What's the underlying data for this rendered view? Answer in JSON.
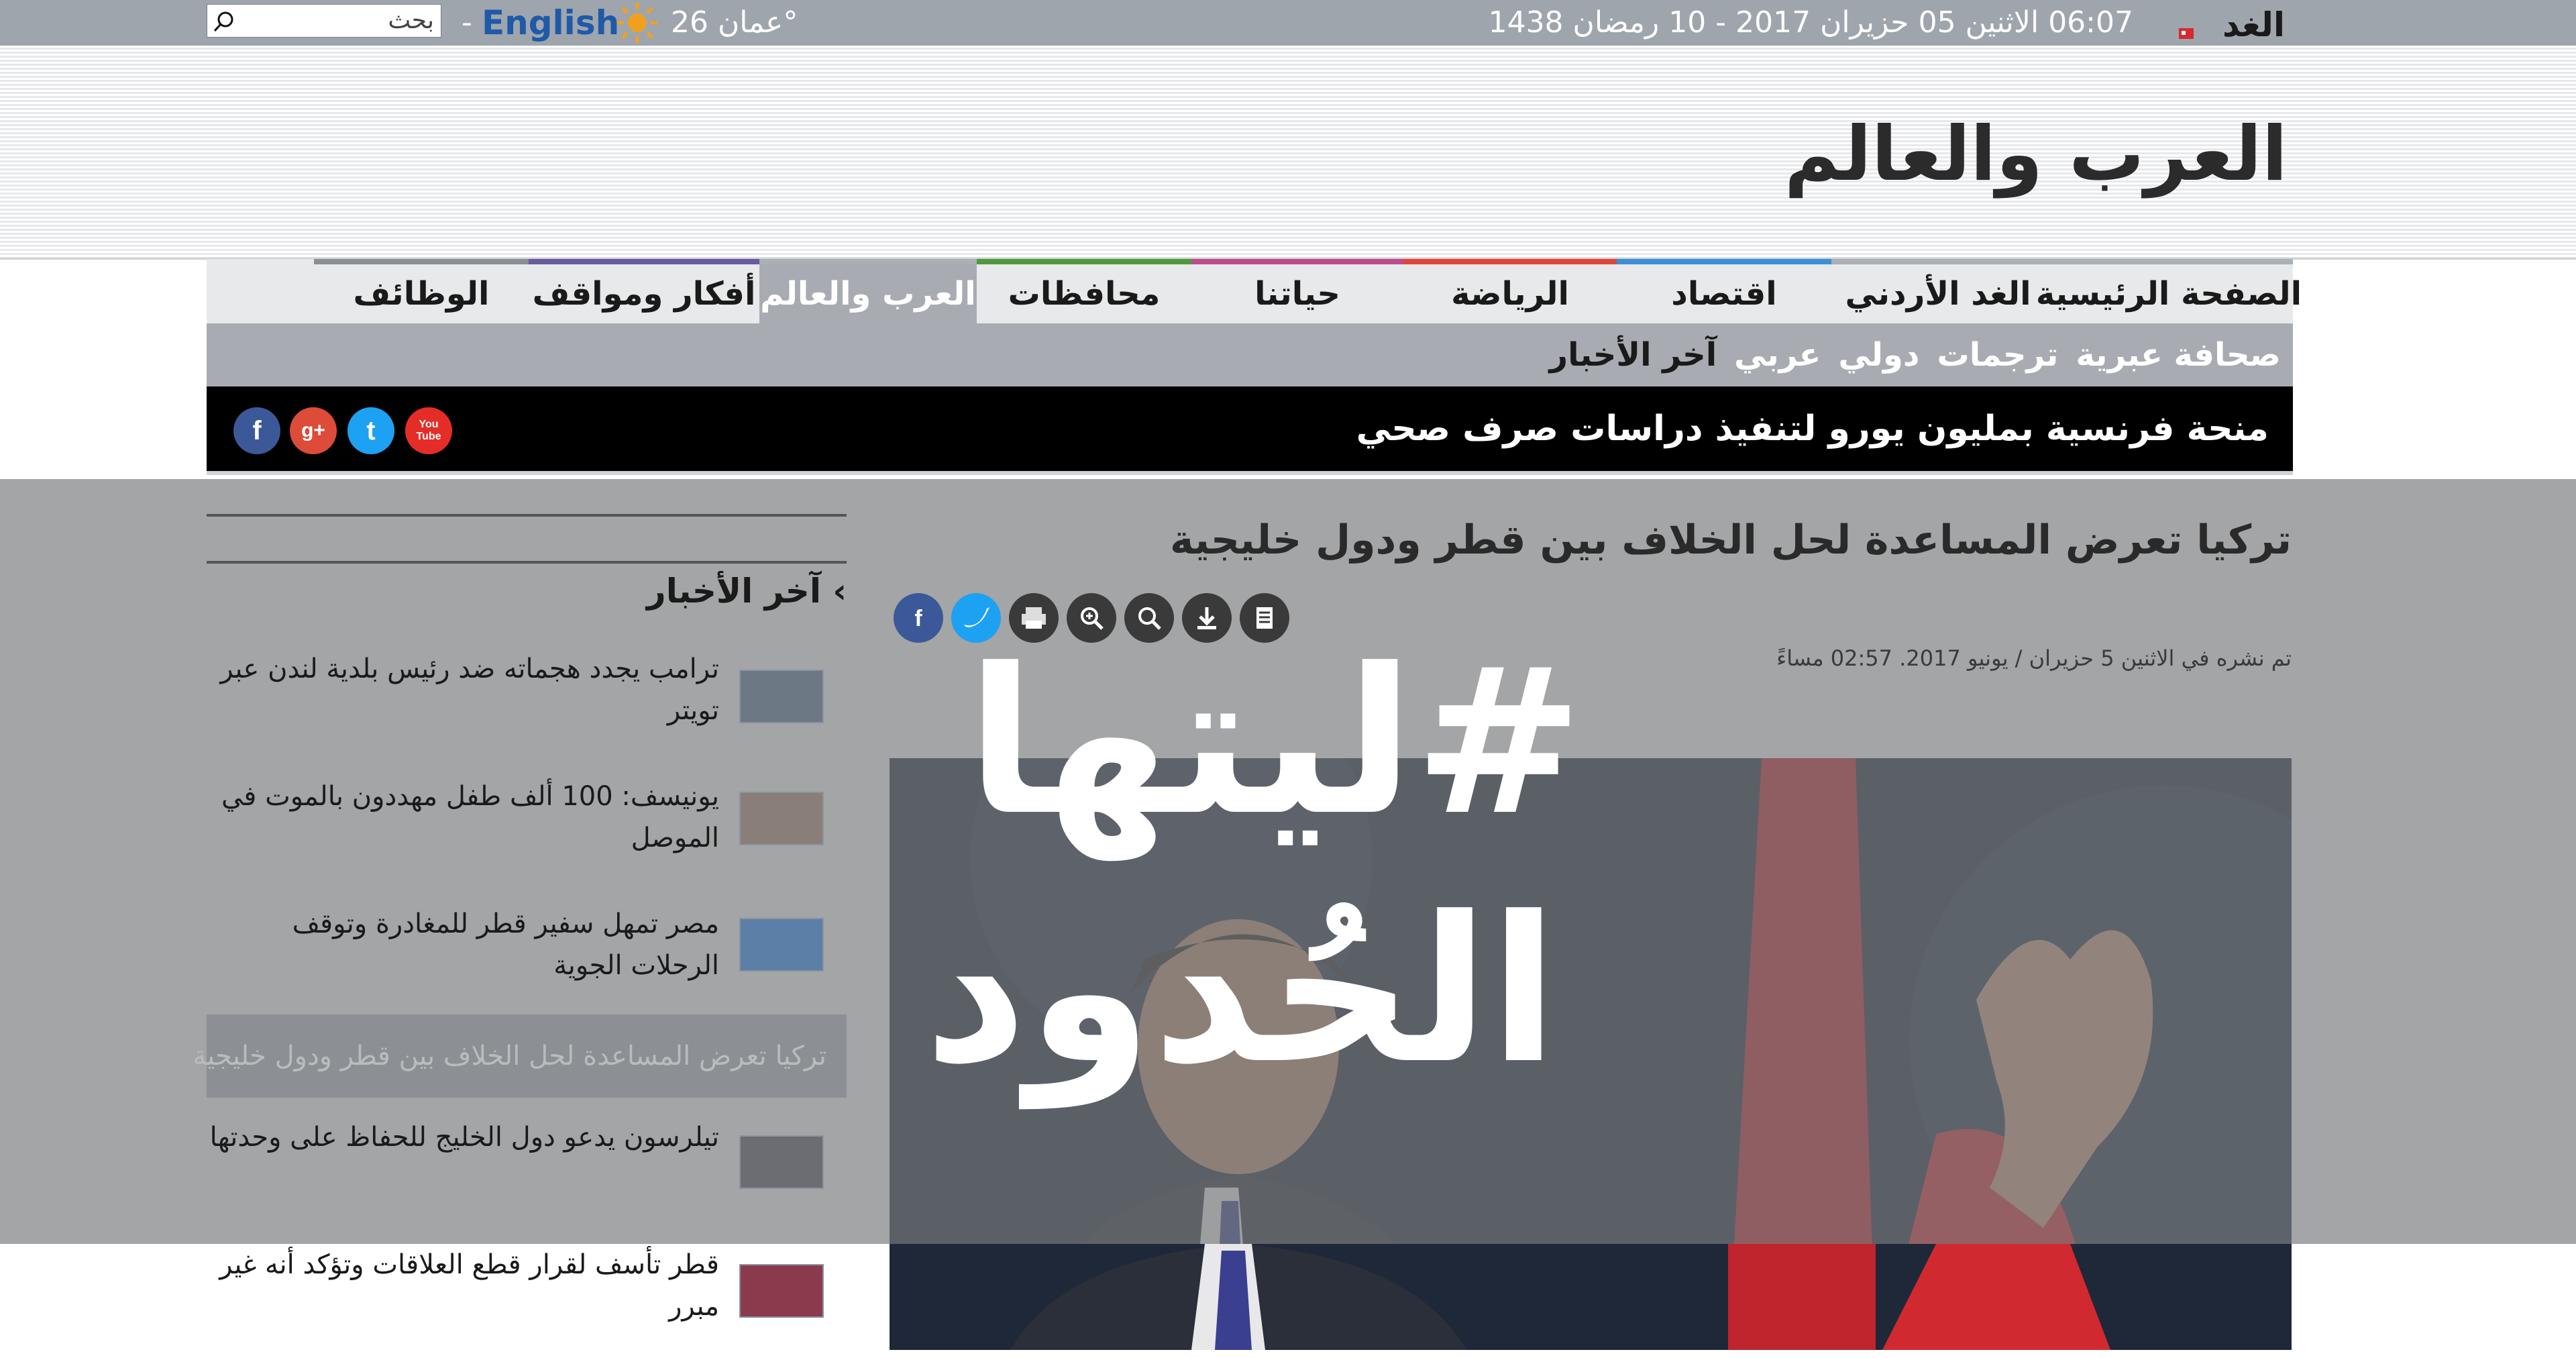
{
  "topbar": {
    "logo_text": "الغد",
    "datetime": "06:07   الاثنين 05 حزيران 2017 - 10 رمضان 1438",
    "weather": "عمان 26°",
    "english_link": "English",
    "separator": "-",
    "search_placeholder": "بحث"
  },
  "header": {
    "section_title": "العرب والعالم"
  },
  "nav": {
    "items": [
      {
        "label": "الصفحة الرئيسية",
        "color": "#aab0b6"
      },
      {
        "label": "الغد الأردني",
        "color": "#aab0b6"
      },
      {
        "label": "اقتصاد",
        "color": "#3a8fd6"
      },
      {
        "label": "الرياضة",
        "color": "#e0443a"
      },
      {
        "label": "حياتنا",
        "color": "#c04a8e"
      },
      {
        "label": "محافظات",
        "color": "#4e9a3a"
      },
      {
        "label": "العرب والعالم",
        "color": "#aab0b6"
      },
      {
        "label": "أفكار ومواقف",
        "color": "#6a5a9e"
      },
      {
        "label": "الوظائف",
        "color": "#8a8f95"
      }
    ],
    "active_index": 6
  },
  "subnav": {
    "items": [
      "آخر الأخبار",
      "عربي",
      "دولي",
      "ترجمات",
      "صحافة عبرية"
    ]
  },
  "ticker": {
    "text": "منحة فرنسية بمليون يورو لتنفيذ دراسات صرف صحي"
  },
  "social": {
    "youtube_label": "You Tube",
    "twitter_label": "t",
    "googleplus_label": "g+",
    "facebook_label": "f"
  },
  "sidebar": {
    "heading": "آخر الأخبار",
    "items": [
      "ترامب يجدد هجماته ضد رئيس بلدية لندن عبر تويتر",
      "يونيسف: 100 ألف طفل مهددون بالموت في الموصل",
      "مصر تمهل سفير قطر للمغادرة وتوقف الرحلات الجوية",
      "تيلرسون يدعو دول الخليج للحفاظ على وحدتها",
      "قطر تأسف لقرار قطع العلاقات وتؤكد أنه غير مبرر"
    ],
    "active_item": "تركيا تعرض المساعدة لحل الخلاف بين قطر ودول خليجية"
  },
  "article": {
    "title": "تركيا تعرض المساعدة لحل الخلاف بين قطر ودول خليجية",
    "date": "تم نشره في الاثنين 5 حزيران / يونيو 2017. 02:57 مساءً"
  },
  "overlay_text": {
    "line1": "#ليتها",
    "line2": "الحُدود"
  },
  "colors": {
    "topbar": "#9ea5ad",
    "ticker_bg": "#000000",
    "overlay": "#7a7c7e"
  }
}
